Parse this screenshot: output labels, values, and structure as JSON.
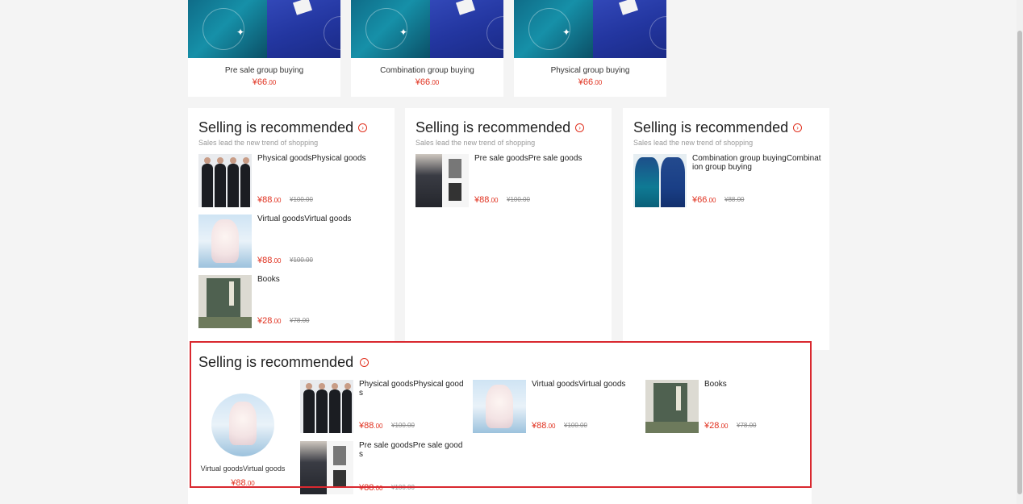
{
  "group_cards": [
    {
      "name": "Pre sale group buying",
      "price_currency": "¥",
      "price_int": "66",
      "price_dec": ".00"
    },
    {
      "name": "Combination group buying",
      "price_currency": "¥",
      "price_int": "66",
      "price_dec": ".00"
    },
    {
      "name": "Physical group buying",
      "price_currency": "¥",
      "price_int": "66",
      "price_dec": ".00"
    }
  ],
  "panels": [
    {
      "title": "Selling is recommended",
      "subtitle": "Sales lead the new trend of shopping",
      "items": [
        {
          "name": "Physical goodsPhysical goods",
          "price_int": "¥88",
          "price_dec": ".00",
          "old_price": "¥100.00",
          "image": "suits"
        },
        {
          "name": "Virtual goodsVirtual goods",
          "price_int": "¥88",
          "price_dec": ".00",
          "old_price": "¥100.00",
          "image": "white-dress"
        },
        {
          "name": "Books",
          "price_int": "¥28",
          "price_dec": ".00",
          "old_price": "¥78.00",
          "image": "book"
        }
      ]
    },
    {
      "title": "Selling is recommended",
      "subtitle": "Sales lead the new trend of shopping",
      "items": [
        {
          "name": "Pre sale goodsPre sale goods",
          "price_int": "¥88",
          "price_dec": ".00",
          "old_price": "¥100.00",
          "image": "skirt"
        }
      ]
    },
    {
      "title": "Selling is recommended",
      "subtitle": "Sales lead the new trend of shopping",
      "items": [
        {
          "name": "Combination group buyingCombination group buying",
          "price_int": "¥66",
          "price_dec": ".00",
          "old_price": "¥88.00",
          "image": "teal-dress"
        }
      ]
    }
  ],
  "bottom_section": {
    "title": "Selling is recommended",
    "featured": {
      "name": "Virtual goodsVirtual goods",
      "price_int": "¥88",
      "price_dec": ".00",
      "image": "white-dress"
    },
    "items": [
      {
        "name": "Physical goodsPhysical goods",
        "price_int": "¥88",
        "price_dec": ".00",
        "old_price": "¥100.00",
        "image": "suits"
      },
      {
        "name": "Virtual goodsVirtual goods",
        "price_int": "¥88",
        "price_dec": ".00",
        "old_price": "¥100.00",
        "image": "white-dress"
      },
      {
        "name": "Books",
        "price_int": "¥28",
        "price_dec": ".00",
        "old_price": "¥78.00",
        "image": "book"
      },
      {
        "name": "Pre sale goodsPre sale goods",
        "price_int": "¥88",
        "price_dec": ".00",
        "old_price": "¥100.00",
        "image": "skirt"
      }
    ]
  },
  "icons": {
    "more": "chevron-right-circle-icon"
  },
  "colors": {
    "price": "#e0301e",
    "highlight_border": "#d9282f",
    "background": "#f4f4f4"
  }
}
